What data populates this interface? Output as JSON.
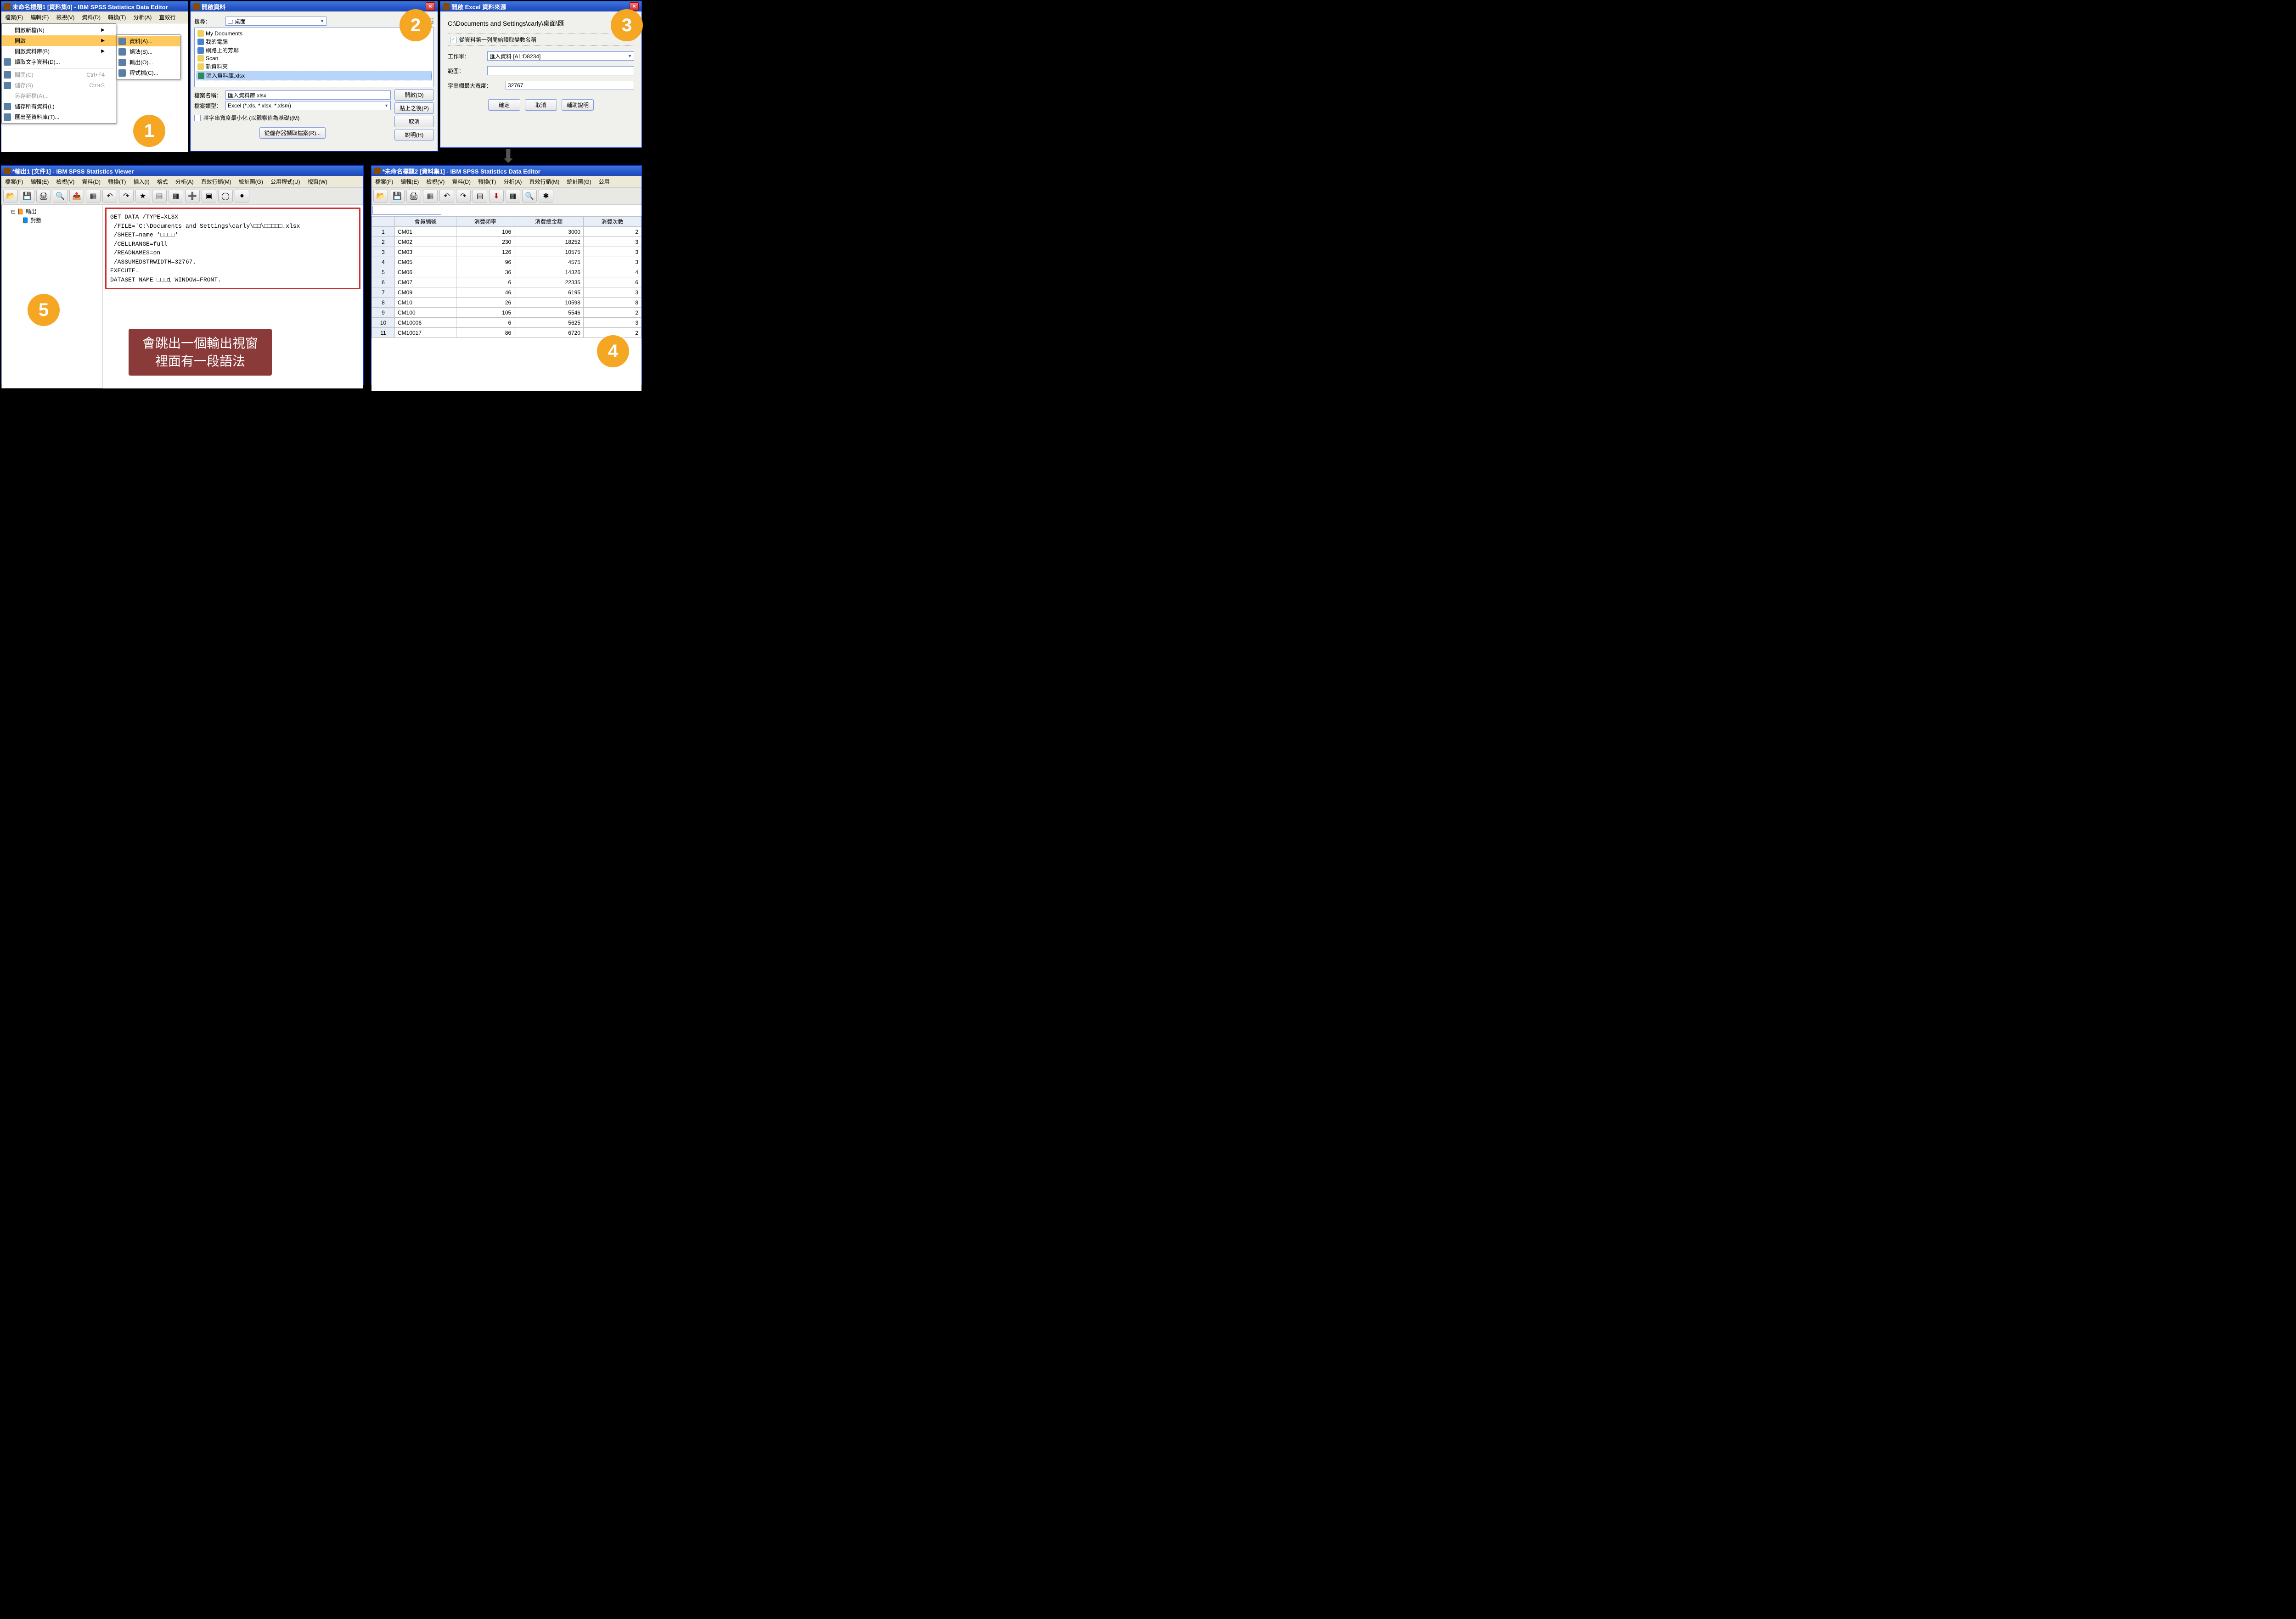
{
  "panel1": {
    "title": "未命名標題1 [資料集0] - IBM SPSS Statistics Data Editor",
    "menubar": [
      "檔案(F)",
      "編輯(E)",
      "檢視(V)",
      "資料(D)",
      "轉換(T)",
      "分析(A)",
      "直效行"
    ],
    "menu": {
      "items": [
        {
          "label": "開啟新檔(N)",
          "arrow": true
        },
        {
          "label": "開啟",
          "arrow": true,
          "hl": true
        },
        {
          "label": "開啟資料庫(B)",
          "arrow": true
        },
        {
          "label": "讀取文字資料(D)...",
          "icon": true,
          "sep_after": true
        },
        {
          "label": "關閉(C)",
          "short": "Ctrl+F4",
          "dis": true,
          "icon": true
        },
        {
          "label": "儲存(S)",
          "short": "Ctrl+S",
          "dis": true,
          "icon": true
        },
        {
          "label": "另存新檔(A)...",
          "dis": true
        },
        {
          "label": "儲存所有資料(L)",
          "icon": true
        },
        {
          "label": "匯出至資料庫(T)...",
          "icon": true
        }
      ],
      "sub": [
        {
          "label": "資料(A)...",
          "icon": true,
          "hl": true
        },
        {
          "label": "語法(S)...",
          "icon": true
        },
        {
          "label": "輸出(O)...",
          "icon": true
        },
        {
          "label": "程式檔(C)...",
          "icon": true
        }
      ]
    }
  },
  "panel2": {
    "title": "開啟資料",
    "lookin_label": "搜尋：",
    "lookin_value": "桌面",
    "files": [
      {
        "name": "My Documents",
        "type": "folder"
      },
      {
        "name": "我的電腦",
        "type": "pc"
      },
      {
        "name": "網路上的芳鄰",
        "type": "net"
      },
      {
        "name": "Scan",
        "type": "folder"
      },
      {
        "name": "新資料夾",
        "type": "folder"
      },
      {
        "name": "匯入資料庫.xlsx",
        "type": "xls",
        "sel": true
      }
    ],
    "filename_label": "檔案名稱：",
    "filename_value": "匯入資料庫.xlsx",
    "filetype_label": "檔案類型：",
    "filetype_value": "Excel (*.xls, *.xlsx, *.xlsm)",
    "checkbox": "將字串寬度最小化 (以觀察值為基礎)(M)",
    "buttons": {
      "open": "開啟(O)",
      "paste": "貼上之後(P)",
      "cancel": "取消",
      "help": "說明(H)",
      "repo": "從儲存器擷取檔案(R)..."
    }
  },
  "panel3": {
    "title": "開啟 Excel 資料來源",
    "path": "C:\\Documents and Settings\\carly\\桌面\\匯",
    "checkbox": "從資料第一列開始讀取變數名稱",
    "worksheet_label": "工作單：",
    "worksheet_value": "匯入資料 [A1:D8234]",
    "range_label": "範圍：",
    "range_value": "",
    "width_label": "字串欄最大寬度：",
    "width_value": "32767",
    "buttons": {
      "ok": "確定",
      "cancel": "取消",
      "help": "輔助說明"
    }
  },
  "panel5": {
    "title": "*輸出1 [文件1] - IBM SPSS Statistics Viewer",
    "menubar": [
      "檔案(F)",
      "編輯(E)",
      "檢視(V)",
      "資料(D)",
      "轉換(T)",
      "插入(I)",
      "格式",
      "分析(A)",
      "直效行銷(M)",
      "統計圖(G)",
      "公用程式(U)",
      "視窗(W)"
    ],
    "tree": {
      "root": "輸出",
      "child": "對數"
    },
    "syntax": "GET DATA /TYPE=XLSX\n /FILE='C:\\Documents and Settings\\carly\\□□\\□□□□□.xlsx\n /SHEET=name '□□□□'\n /CELLRANGE=full\n /READNAMES=on\n /ASSUMEDSTRWIDTH=32767.\nEXECUTE.\nDATASET NAME □□□1 WINDOW=FRONT."
  },
  "annotation": {
    "line1": "會跳出一個輸出視窗",
    "line2": "裡面有一段語法"
  },
  "panel4": {
    "title": "*未命名標題2 [資料集1] - IBM SPSS Statistics Data Editor",
    "menubar": [
      "檔案(F)",
      "編輯(E)",
      "檢視(V)",
      "資料(D)",
      "轉換(T)",
      "分析(A)",
      "直效行銷(M)",
      "統計圖(G)",
      "公用"
    ],
    "columns": [
      "會員編號",
      "消費頻率",
      "消費總金額",
      "消費次數"
    ],
    "rows": [
      {
        "n": 1,
        "id": "CM01",
        "a": 106,
        "b": 3000,
        "c": 2
      },
      {
        "n": 2,
        "id": "CM02",
        "a": 230,
        "b": 18252,
        "c": 3
      },
      {
        "n": 3,
        "id": "CM03",
        "a": 126,
        "b": 10575,
        "c": 3
      },
      {
        "n": 4,
        "id": "CM05",
        "a": 96,
        "b": 4575,
        "c": 3
      },
      {
        "n": 5,
        "id": "CM06",
        "a": 36,
        "b": 14326,
        "c": 4
      },
      {
        "n": 6,
        "id": "CM07",
        "a": 6,
        "b": 22335,
        "c": 6
      },
      {
        "n": 7,
        "id": "CM09",
        "a": 46,
        "b": 6195,
        "c": 3
      },
      {
        "n": 8,
        "id": "CM10",
        "a": 26,
        "b": 10598,
        "c": 8
      },
      {
        "n": 9,
        "id": "CM100",
        "a": 105,
        "b": 5546,
        "c": 2
      },
      {
        "n": 10,
        "id": "CM10006",
        "a": 6,
        "b": 5625,
        "c": 3
      },
      {
        "n": 11,
        "id": "CM10017",
        "a": 86,
        "b": 6720,
        "c": 2
      }
    ]
  },
  "badges": {
    "b1": "1",
    "b2": "2",
    "b3": "3",
    "b4": "4",
    "b5": "5"
  }
}
